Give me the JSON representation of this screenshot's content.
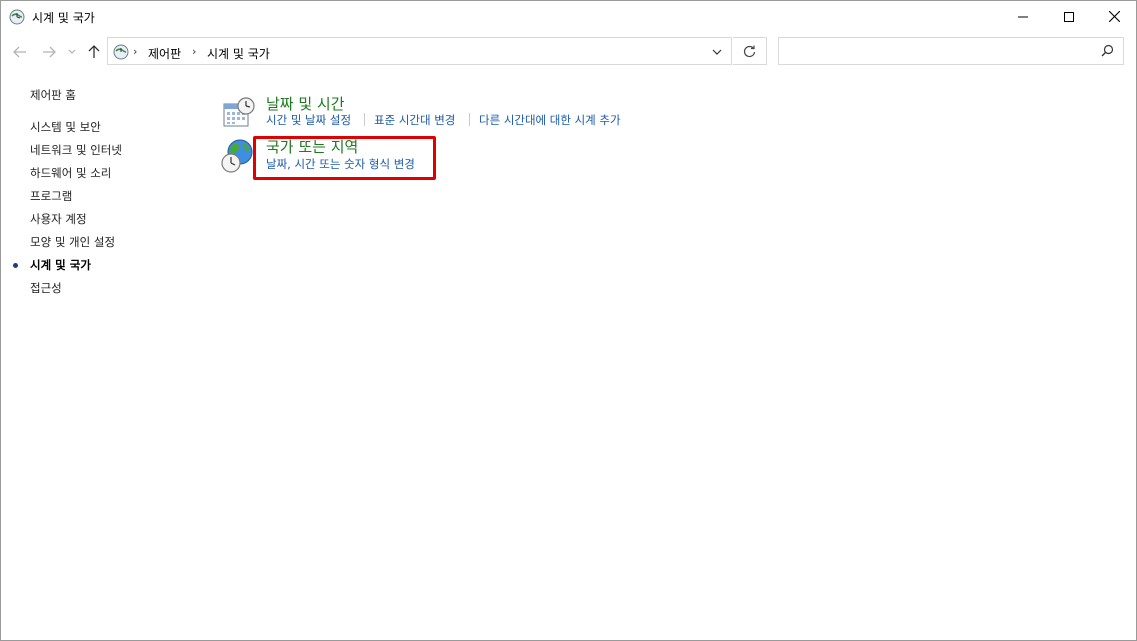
{
  "window": {
    "title": "시계 및 국가",
    "buttons": {
      "minimize": "minimize",
      "maximize": "maximize",
      "close": "close"
    }
  },
  "navbar": {
    "breadcrumbs": [
      "제어판",
      "시계 및 국가"
    ],
    "search_placeholder": ""
  },
  "sidebar": {
    "home": "제어판 홈",
    "items": [
      {
        "label": "시스템 및 보안"
      },
      {
        "label": "네트워크 및 인터넷"
      },
      {
        "label": "하드웨어 및 소리"
      },
      {
        "label": "프로그램"
      },
      {
        "label": "사용자 계정"
      },
      {
        "label": "모양 및 개인 설정"
      },
      {
        "label": "시계 및 국가",
        "current": true
      },
      {
        "label": "접근성"
      }
    ]
  },
  "main": {
    "categories": [
      {
        "title": "날짜 및 시간",
        "icon": "calendar-clock-icon",
        "links": [
          "시간 및 날짜 설정",
          "표준 시간대 변경",
          "다른 시간대에 대한 시계 추가"
        ]
      },
      {
        "title": "국가 또는 지역",
        "icon": "globe-clock-icon",
        "links": [
          "날짜, 시간 또는 숫자 형식 변경"
        ],
        "highlighted": true
      }
    ]
  },
  "colors": {
    "category_title": "#1e7a1e",
    "link": "#1c5ba8",
    "highlight": "#e00000"
  }
}
